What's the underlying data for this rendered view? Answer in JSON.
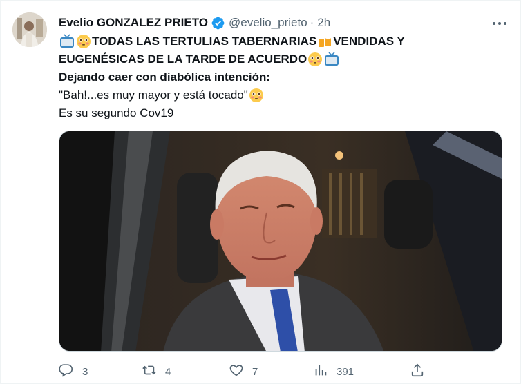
{
  "tweet": {
    "display_name": "Evelio GONZALEZ PRIETO",
    "handle": "@evelio_prieto",
    "separator": "·",
    "time": "2h",
    "lines": {
      "line1_a": "TODAS LAS TERTULIAS TABERNARIAS",
      "line1_b": " VENDIDAS Y",
      "line2": "EUGENÉSICAS DE LA TARDE DE ACUERDO",
      "line3": "Dejando caer con diabólica intención:",
      "line4": "\"Bah!...es muy mayor y está tocado\"",
      "line5": "Es su segundo Cov19"
    },
    "icons": {
      "line1": [
        "tv-emoji",
        "flushed-face-emoji",
        "beer-mugs-emoji"
      ],
      "line2": [
        "flushed-face-emoji",
        "tv-emoji"
      ],
      "line4": [
        "flushed-face-emoji"
      ]
    },
    "metrics": {
      "replies": "3",
      "retweets": "4",
      "likes": "7",
      "views": "391"
    }
  },
  "colors": {
    "text": "#0f1419",
    "secondary": "#536471",
    "verified": "#1d9bf0",
    "border": "#cfd9de"
  }
}
